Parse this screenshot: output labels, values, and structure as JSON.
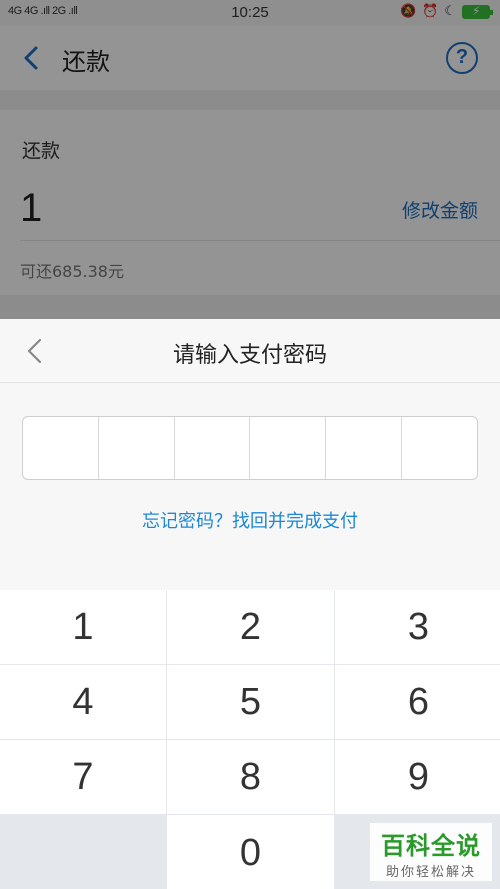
{
  "status_bar": {
    "signal": "4G 4G .ıll 2G .ıll",
    "time": "10:25",
    "icons": [
      "silent-icon",
      "alarm-icon",
      "moon-icon",
      "battery-icon"
    ]
  },
  "navbar": {
    "title": "还款",
    "help_glyph": "?"
  },
  "repay": {
    "label": "还款",
    "amount": "1",
    "modify_label": "修改金额",
    "available": "可还685.38元"
  },
  "password_sheet": {
    "title": "请输入支付密码",
    "pin_length": 6,
    "forgot_link": "忘记密码？找回并完成支付"
  },
  "keypad": {
    "keys": [
      "1",
      "2",
      "3",
      "4",
      "5",
      "6",
      "7",
      "8",
      "9",
      "",
      "0",
      ""
    ]
  },
  "watermark": {
    "main": "百科全说",
    "sub": "助你轻松解决"
  },
  "colors": {
    "accent": "#1e6fc2",
    "link": "#1e88d2",
    "overlay": "rgba(0,0,0,0.42)"
  }
}
